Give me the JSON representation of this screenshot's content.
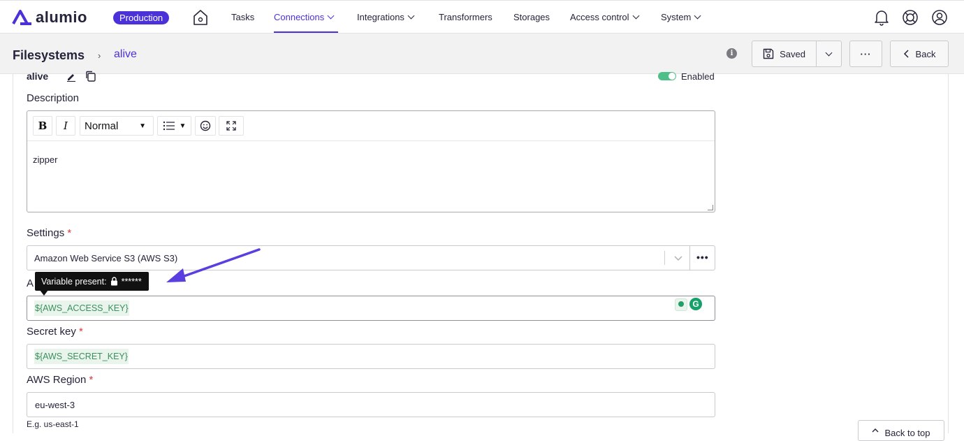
{
  "brand": {
    "name": "alumio",
    "env_badge": "Production",
    "accent": "#4a32d8"
  },
  "nav": {
    "items": [
      {
        "label": "Tasks",
        "has_menu": false,
        "active": false
      },
      {
        "label": "Connections",
        "has_menu": true,
        "active": true
      },
      {
        "label": "Integrations",
        "has_menu": true,
        "active": false
      },
      {
        "label": "Transformers",
        "has_menu": false,
        "active": false
      },
      {
        "label": "Storages",
        "has_menu": false,
        "active": false
      },
      {
        "label": "Access control",
        "has_menu": true,
        "active": false
      },
      {
        "label": "System",
        "has_menu": true,
        "active": false
      }
    ],
    "icons": [
      "home-icon",
      "bell-icon",
      "help-lifebuoy-icon",
      "user-icon"
    ]
  },
  "header": {
    "breadcrumb_root": "Filesystems",
    "breadcrumb_sep": "›",
    "breadcrumb_current": "alive",
    "info": "i",
    "saved_label": "Saved",
    "more_label": "···",
    "back_label": "Back"
  },
  "form": {
    "name": "alive",
    "enabled_label": "Enabled",
    "enabled": true,
    "description_label": "Description",
    "editor": {
      "bold": "B",
      "italic": "I",
      "block_style": "Normal",
      "content": "zipper"
    },
    "settings_label": "Settings",
    "settings_value": "Amazon Web Service S3 (AWS S3)",
    "settings_more": "•••",
    "access_key_label_visible": "A",
    "access_key_value": "${AWS_ACCESS_KEY}",
    "tooltip_text": "Variable present:",
    "tooltip_mask": "******",
    "secret_key_label": "Secret key",
    "secret_key_value": "${AWS_SECRET_KEY}",
    "region_label": "AWS Region",
    "region_value": "eu-west-3",
    "region_hint": "E.g. us-east-1",
    "required_mark": "*",
    "back_to_top": "Back to top"
  },
  "colors": {
    "variable_text": "#3b8f5c",
    "variable_bg": "#e9f4ec",
    "toggle_on": "#4fbf8a",
    "arrow": "#5a3ee0"
  }
}
